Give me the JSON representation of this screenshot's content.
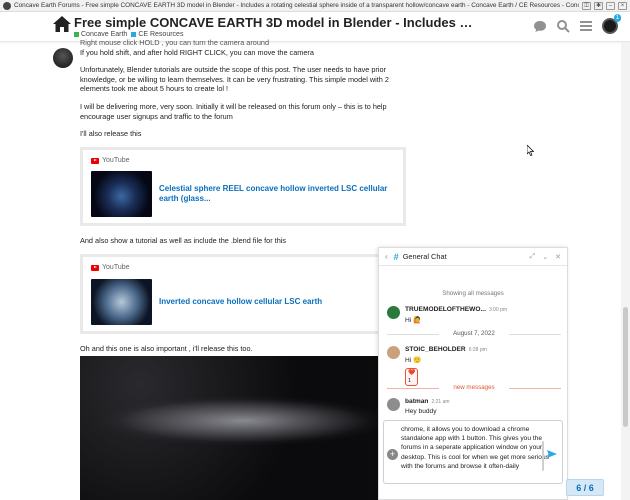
{
  "browser": {
    "tab_title": "Concave Earth Forums - Free simple CONCAVE EARTH 3D model in Blender - Includes a rotating celestial sphere inside of a transparent hollow/concave earth - Concave Earth / CE Resources - Concave E..."
  },
  "header": {
    "topic_title": "Free simple CONCAVE EARTH 3D model in Blender - Includes a rotating cel...",
    "category": "Concave Earth",
    "subcategory": "CE Resources",
    "notification_count": "1",
    "icons": [
      "home-icon",
      "chat-bubble-icon",
      "search-icon",
      "hamburger-menu-icon",
      "user-avatar"
    ],
    "colors": {
      "category": "#3ab54a",
      "subcategory": "#25aae1"
    }
  },
  "post": {
    "cut_line": "Right mouse click HOLD , you can turn the camera around",
    "line1": "If you hold shift, and after hold RIGHT CLICK, you can move the camera",
    "para1": "Unfortunately, Blender tutorials are outside the scope of this post. The user needs to have prior knowledge, or be willing to learn themselves. It can be very frustrating. This simple model with 2 elements took me about 5 hours to create lol !",
    "para2": "I will be delivering more, very soon. Initially it will be released on this forum only – this is to help encourage user signups and traffic to the forum",
    "para3": "I'll also release this",
    "onebox1": {
      "source": "YouTube",
      "link": "Celestial sphere REEL concave hollow inverted LSC cellular earth (glass..."
    },
    "para4": "And also show a tutorial as well as include the .blend file for this",
    "onebox2": {
      "source": "YouTube",
      "link": "Inverted concave hollow cellular LSC earth"
    },
    "para5": "Oh and this one is also important , i'll release this too."
  },
  "chat": {
    "title": "General Chat",
    "showing_all": "Showing all messages",
    "messages": [
      {
        "user": "TRUEMODELOFTHEWO...",
        "time": "3:00 pm",
        "text": "Hi 🙋"
      },
      {
        "user": "STOIC_BEHOLDER",
        "time": "6:28 pm",
        "text": "Hi 🙂",
        "reaction": "❤️ 1"
      },
      {
        "user": "batman",
        "time": "2:21 am",
        "text": "Hey buddy"
      }
    ],
    "date_divider": "August 7, 2022",
    "new_messages": "new messages",
    "composer_text": "chrome, it allows you to download a chrome standalone app with 1 button. This gives you the forums in a seperate application window on your desktop. This is cool for when we get more serious with the forums and browse it often-daily"
  },
  "progress": "6 / 6"
}
